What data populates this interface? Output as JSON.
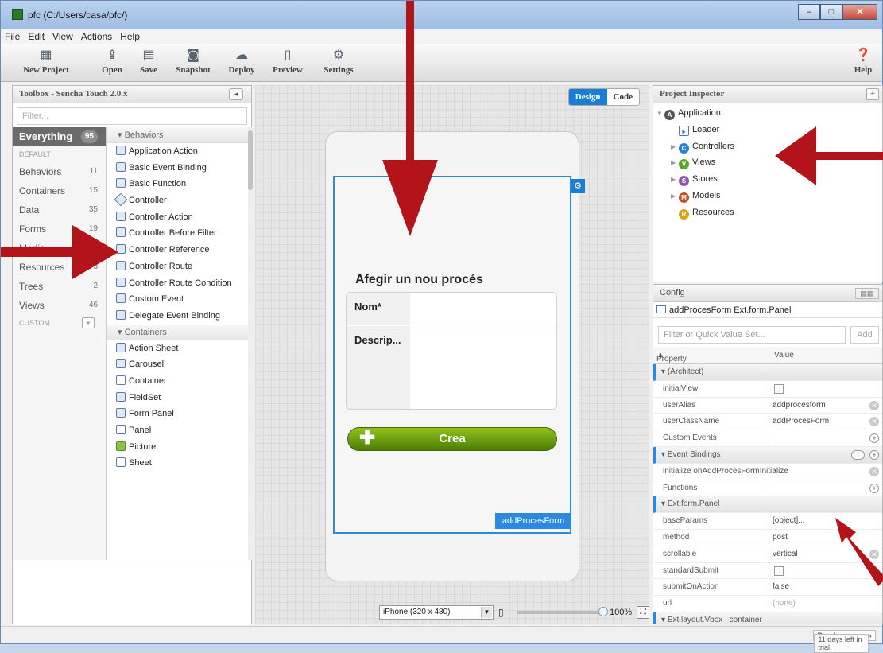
{
  "window": {
    "title": "pfc (C:/Users/casa/pfc/)"
  },
  "menu": [
    "File",
    "Edit",
    "View",
    "Actions",
    "Help"
  ],
  "toolbar": {
    "new_project": "New Project",
    "open": "Open",
    "save": "Save",
    "snapshot": "Snapshot",
    "deploy": "Deploy",
    "preview": "Preview",
    "settings": "Settings",
    "help": "Help"
  },
  "toolbox": {
    "title": "Toolbox - Sencha Touch 2.0.x",
    "filter_placeholder": "Filter...",
    "categories": [
      {
        "label": "Everything",
        "count": "95"
      },
      {
        "label": "DEFAULT",
        "count": ""
      },
      {
        "label": "Behaviors",
        "count": "11"
      },
      {
        "label": "Containers",
        "count": "15"
      },
      {
        "label": "Data",
        "count": "35"
      },
      {
        "label": "Forms",
        "count": "19"
      },
      {
        "label": "Media",
        "count": ""
      },
      {
        "label": "Resources",
        "count": "3"
      },
      {
        "label": "Trees",
        "count": "2"
      },
      {
        "label": "Views",
        "count": "46"
      },
      {
        "label": "CUSTOM",
        "count": ""
      }
    ],
    "group_behaviors": "Behaviors",
    "group_containers": "Containers",
    "behaviors": [
      "Application Action",
      "Basic Event Binding",
      "Basic Function",
      "Controller",
      "Controller Action",
      "Controller Before Filter",
      "Controller Reference",
      "Controller Route",
      "Controller Route Condition",
      "Custom Event",
      "Delegate Event Binding"
    ],
    "containers": [
      "Action Sheet",
      "Carousel",
      "Container",
      "FieldSet",
      "Form Panel",
      "Panel",
      "Picture",
      "Sheet"
    ]
  },
  "canvas": {
    "design": "Design",
    "code": "Code",
    "form_title": "Afegir un nou procés",
    "field_nom": "Nom*",
    "field_descrip": "Descrip...",
    "button": "Crea",
    "component_label": "addProcesForm",
    "device": "iPhone (320 x 480)",
    "zoom": "100%"
  },
  "inspector": {
    "title": "Project Inspector",
    "nodes": [
      {
        "label": "Application",
        "icon": "A",
        "color": "#4a4a4a"
      },
      {
        "label": "Loader",
        "icon": "loader",
        "color": "#2b6cb0"
      },
      {
        "label": "Controllers",
        "icon": "C",
        "color": "#2b7fd4"
      },
      {
        "label": "Views",
        "icon": "V",
        "color": "#5aa22b"
      },
      {
        "label": "Stores",
        "icon": "S",
        "color": "#8a5aa8"
      },
      {
        "label": "Models",
        "icon": "M",
        "color": "#c0522a"
      },
      {
        "label": "Resources",
        "icon": "R",
        "color": "#d9a21c"
      }
    ]
  },
  "config": {
    "title": "Config",
    "class_line": "addProcesForm Ext.form.Panel",
    "filter_placeholder": "Filter or Quick Value Set...",
    "add": "Add",
    "col_property": "Property",
    "col_value": "Value",
    "rows": [
      {
        "type": "group",
        "key": "(Architect)"
      },
      {
        "key": "initialView",
        "value": "",
        "ctl": "checkbox"
      },
      {
        "key": "userAlias",
        "value": "addprocesform",
        "ctl": "x"
      },
      {
        "key": "userClassName",
        "value": "addProcesForm",
        "ctl": "x"
      },
      {
        "key": "Custom Events",
        "value": "",
        "ctl": "plus"
      },
      {
        "type": "group",
        "key": "Event Bindings",
        "ctl": "plus",
        "badge": "1"
      },
      {
        "key": "initialize onAddProcesFormInitialize",
        "value": "",
        "ctl": "x"
      },
      {
        "key": "Functions",
        "value": "",
        "ctl": "plus"
      },
      {
        "type": "group",
        "key": "Ext.form.Panel"
      },
      {
        "key": "baseParams",
        "value": "[object]...",
        "ctl": ""
      },
      {
        "key": "method",
        "value": "post",
        "ctl": ""
      },
      {
        "key": "scrollable",
        "value": "vertical",
        "ctl": "x"
      },
      {
        "key": "standardSubmit",
        "value": "",
        "ctl": "checkbox"
      },
      {
        "key": "submitOnAction",
        "value": "false",
        "ctl": ""
      },
      {
        "key": "url",
        "value": "(none)",
        "ctl": "",
        "dim": true
      },
      {
        "type": "group",
        "key": "Ext.layout.Vbox : container"
      }
    ]
  },
  "status": {
    "trial": "11 days left in trial.",
    "purchase": "Purchase now »"
  }
}
